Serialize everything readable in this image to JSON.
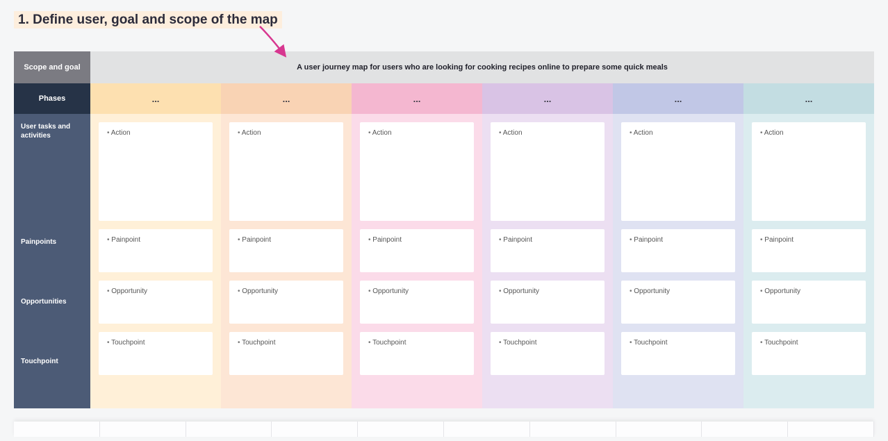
{
  "heading": "1. Define user, goal and scope of the map",
  "scope": {
    "label": "Scope and goal",
    "text": "A user journey map for users who are looking for cooking recipes online to prepare some quick meals"
  },
  "phases_label": "Phases",
  "rows": {
    "tasks": "User tasks and activities",
    "pain": "Painpoints",
    "opp": "Opportunities",
    "touch": "Touchpoint"
  },
  "columns": [
    {
      "phase": "...",
      "action": "Action",
      "pain": "Painpoint",
      "opp": "Opportunity",
      "touch": "Touchpoint"
    },
    {
      "phase": "...",
      "action": "Action",
      "pain": "Painpoint",
      "opp": "Opportunity",
      "touch": "Touchpoint"
    },
    {
      "phase": "...",
      "action": "Action",
      "pain": "Painpoint",
      "opp": "Opportunity",
      "touch": "Touchpoint"
    },
    {
      "phase": "...",
      "action": "Action",
      "pain": "Painpoint",
      "opp": "Opportunity",
      "touch": "Touchpoint"
    },
    {
      "phase": "...",
      "action": "Action",
      "pain": "Painpoint",
      "opp": "Opportunity",
      "touch": "Touchpoint"
    },
    {
      "phase": "...",
      "action": "Action",
      "pain": "Painpoint",
      "opp": "Opportunity",
      "touch": "Touchpoint"
    }
  ]
}
